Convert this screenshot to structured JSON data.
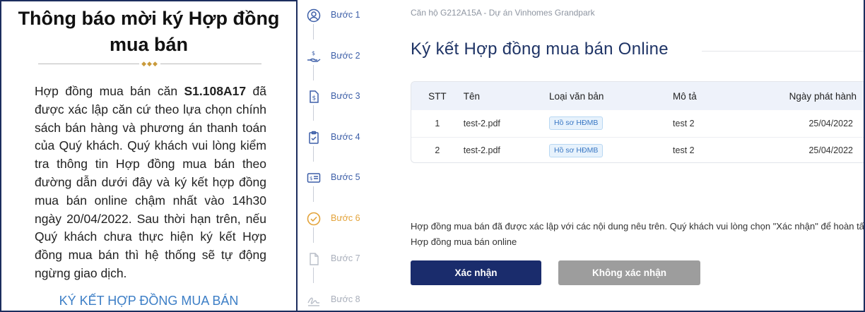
{
  "notice": {
    "title": "Thông báo mời ký Hợp đồng mua bán",
    "body_before": "Hợp đồng mua bán căn ",
    "unit_code": "S1.108A17",
    "body_after": " đã được xác lập căn cứ theo lựa chọn chính sách bán hàng và phương án thanh toán của Quý khách. Quý khách vui lòng kiểm tra thông tin Hợp đồng mua bán theo đường dẫn dưới đây và ký kết hợp đồng mua bán online chậm nhất vào 14h30 ngày 20/04/2022. Sau thời hạn trên, nếu Quý khách chưa thực hiện ký kết Hợp đồng mua bán thì hệ thống sẽ tự động ngừng giao dịch.",
    "link_label": "KÝ KẾT HỢP ĐỒNG MUA BÁN"
  },
  "steps": [
    {
      "label": "Bước 1",
      "icon": "user-circle-icon",
      "state": "done"
    },
    {
      "label": "Bước 2",
      "icon": "hand-money-icon",
      "state": "done"
    },
    {
      "label": "Bước 3",
      "icon": "document-dollar-icon",
      "state": "done"
    },
    {
      "label": "Bước 4",
      "icon": "clipboard-check-icon",
      "state": "done"
    },
    {
      "label": "Bước 5",
      "icon": "card-icon",
      "state": "done"
    },
    {
      "label": "Bước 6",
      "icon": "check-circle-icon",
      "state": "current"
    },
    {
      "label": "Bước 7",
      "icon": "file-icon",
      "state": "future"
    },
    {
      "label": "Bước 8",
      "icon": "signature-icon",
      "state": "future"
    }
  ],
  "main": {
    "breadcrumb": "Căn hộ G212A15A - Dự án Vinhomes Grandpark",
    "title": "Ký kết Hợp đồng mua bán Online",
    "table": {
      "headers": [
        "STT",
        "Tên",
        "Loại văn bản",
        "Mô tả",
        "Ngày phát hành"
      ],
      "rows": [
        {
          "stt": "1",
          "name": "test-2.pdf",
          "type": "Hồ sơ HĐMB",
          "desc": "test 2",
          "date": "25/04/2022"
        },
        {
          "stt": "2",
          "name": "test-2.pdf",
          "type": "Hồ sơ HĐMB",
          "desc": "test 2",
          "date": "25/04/2022"
        }
      ]
    },
    "confirm_text": "Hợp đồng mua bán đã được xác lập với các nội dung nêu trên. Quý khách vui lòng chọn \"Xác nhận\" để hoàn tất ký kết Hợp đồng mua bán online",
    "confirm_button": "Xác nhận",
    "reject_button": "Không xác nhận"
  },
  "colors": {
    "primary": "#1a2c6c",
    "step_done": "#3d5fa8",
    "step_current": "#e3a33a",
    "step_future": "#a9afbb",
    "link": "#3c7ec6",
    "disabled": "#9d9d9d"
  }
}
